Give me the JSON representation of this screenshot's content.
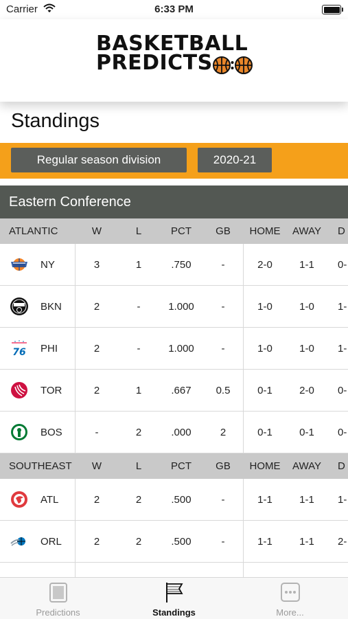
{
  "status_bar": {
    "carrier": "Carrier",
    "time": "6:33 PM"
  },
  "header": {
    "logo_line1": "BASKETBALL",
    "logo_line2": "PREDICTS"
  },
  "page_title": "Standings",
  "filters": {
    "division": "Regular season division",
    "season": "2020-21"
  },
  "conference": "Eastern Conference",
  "columns": {
    "w": "W",
    "l": "L",
    "pct": "PCT",
    "gb": "GB",
    "home": "HOME",
    "away": "AWAY",
    "div": "D"
  },
  "divisions": [
    {
      "name": "ATLANTIC",
      "teams": [
        {
          "abbr": "NY",
          "w": "3",
          "l": "1",
          "pct": ".750",
          "gb": "-",
          "home": "2-0",
          "away": "1-1",
          "div": "0-"
        },
        {
          "abbr": "BKN",
          "w": "2",
          "l": "-",
          "pct": "1.000",
          "gb": "-",
          "home": "1-0",
          "away": "1-0",
          "div": "1-"
        },
        {
          "abbr": "PHI",
          "w": "2",
          "l": "-",
          "pct": "1.000",
          "gb": "-",
          "home": "1-0",
          "away": "1-0",
          "div": "1-"
        },
        {
          "abbr": "TOR",
          "w": "2",
          "l": "1",
          "pct": ".667",
          "gb": "0.5",
          "home": "0-1",
          "away": "2-0",
          "div": "0-"
        },
        {
          "abbr": "BOS",
          "w": "-",
          "l": "2",
          "pct": ".000",
          "gb": "2",
          "home": "0-1",
          "away": "0-1",
          "div": "0-"
        }
      ]
    },
    {
      "name": "SOUTHEAST",
      "teams": [
        {
          "abbr": "ATL",
          "w": "2",
          "l": "2",
          "pct": ".500",
          "gb": "-",
          "home": "1-1",
          "away": "1-1",
          "div": "1-"
        },
        {
          "abbr": "ORL",
          "w": "2",
          "l": "2",
          "pct": ".500",
          "gb": "-",
          "home": "1-1",
          "away": "1-1",
          "div": "2-"
        }
      ]
    }
  ],
  "tabs": [
    {
      "label": "Predictions"
    },
    {
      "label": "Standings"
    },
    {
      "label": "More..."
    }
  ],
  "colors": {
    "accent": "#F5A01A",
    "conference_bar": "#535853",
    "button": "#5b5e5b"
  }
}
